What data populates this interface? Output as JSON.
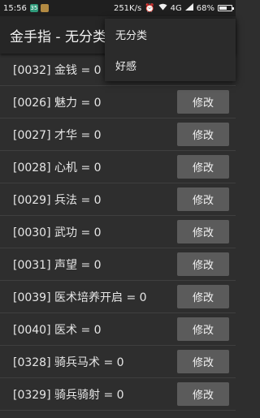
{
  "status_bar": {
    "time": "15:56",
    "speed": "251K/s",
    "network": "4G",
    "battery": "68%"
  },
  "app_bar": {
    "title": "金手指 - 无分类"
  },
  "menu": {
    "items": [
      "无分类",
      "好感"
    ]
  },
  "list": {
    "rows": [
      {
        "label": "[0032] 金钱 = 0"
      },
      {
        "label": "[0026] 魅力 = 0",
        "button": "修改"
      },
      {
        "label": "[0027] 才华 = 0",
        "button": "修改"
      },
      {
        "label": "[0028] 心机 = 0",
        "button": "修改"
      },
      {
        "label": "[0029] 兵法 = 0",
        "button": "修改"
      },
      {
        "label": "[0030] 武功 = 0",
        "button": "修改"
      },
      {
        "label": "[0031] 声望 = 0",
        "button": "修改"
      },
      {
        "label": "[0039] 医术培养开启 = 0",
        "button": "修改"
      },
      {
        "label": "[0040] 医术 = 0",
        "button": "修改"
      },
      {
        "label": "[0328] 骑兵马术 = 0",
        "button": "修改"
      },
      {
        "label": "[0329] 骑兵骑射 = 0",
        "button": "修改"
      }
    ]
  }
}
